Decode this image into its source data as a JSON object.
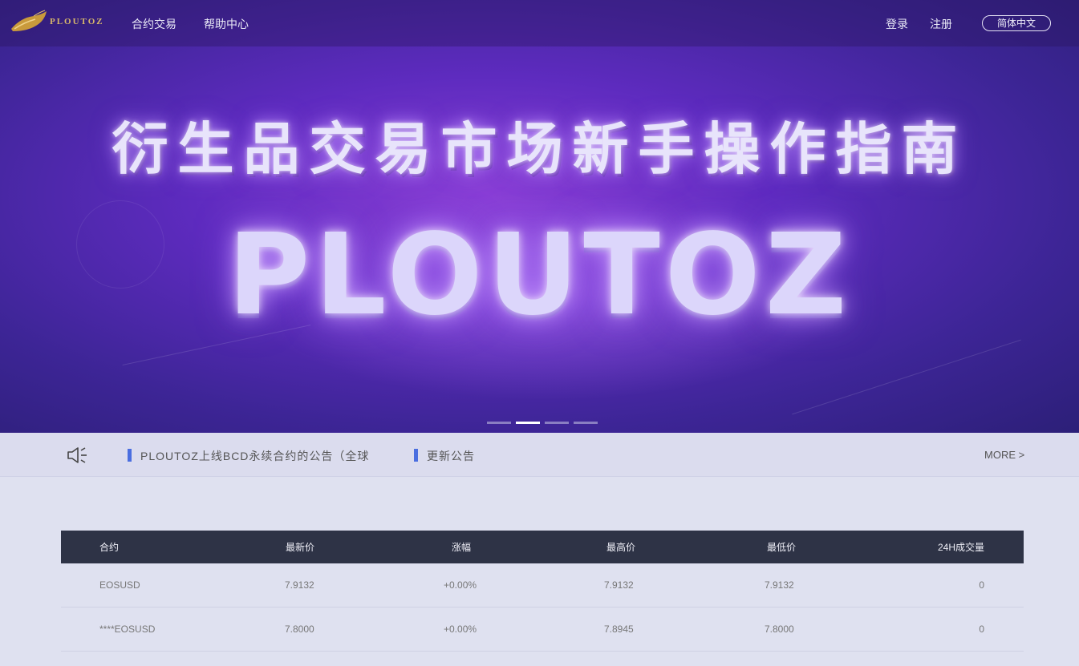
{
  "nav": {
    "brand": "PLOUTOZ",
    "links": [
      "合约交易",
      "帮助中心"
    ],
    "login": "登录",
    "register": "注册",
    "language": "简体中文"
  },
  "banner": {
    "title": "衍生品交易市场新手操作指南",
    "logo_text": "PLOUTOZ",
    "slides": 4,
    "active_slide": 2
  },
  "notices": {
    "items": [
      "PLOUTOZ上线BCD永续合约的公告（全球",
      "更新公告"
    ],
    "more": "MORE >"
  },
  "market_table": {
    "headers": [
      "合约",
      "最新价",
      "涨幅",
      "最高价",
      "最低价",
      "24H成交量"
    ],
    "rows": [
      [
        "EOSUSD",
        "7.9132",
        "+0.00%",
        "7.9132",
        "7.9132",
        "0"
      ],
      [
        "****EOSUSD",
        "7.8000",
        "+0.00%",
        "7.8945",
        "7.8000",
        "0"
      ]
    ]
  },
  "colors": {
    "accent": "#4a6ee0",
    "table_header": "#2e3346",
    "page_bg": "#dfe1f0"
  }
}
